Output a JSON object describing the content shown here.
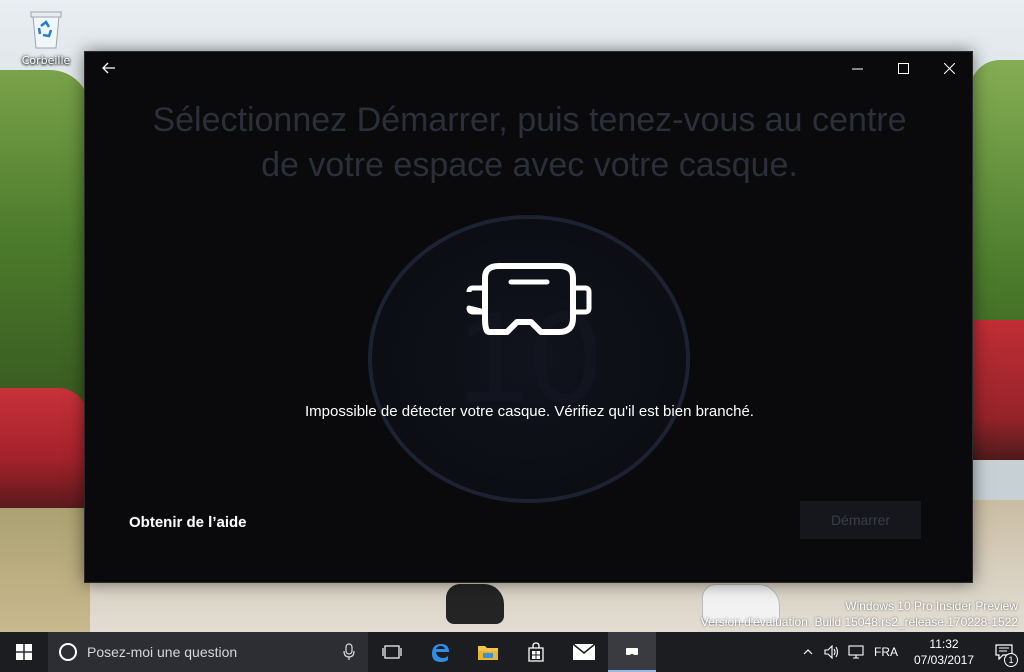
{
  "desktop": {
    "recycle_bin_label": "Corbeille",
    "watermark_line1": "Windows 10 Pro Insider Preview",
    "watermark_line2": "Version d'évaluation. Build 15048.rs2_release.170228-1522"
  },
  "window": {
    "heading": "Sélectionnez Démarrer, puis tenez-vous au centre de votre espace avec votre casque.",
    "ring_number": "10",
    "error_message": "Impossible de détecter votre casque. Vérifiez qu'il est bien branché.",
    "help_link": "Obtenir de l’aide",
    "start_button": "Démarrer"
  },
  "taskbar": {
    "search_placeholder": "Posez-moi une question",
    "language": "FRA",
    "time": "11:32",
    "date": "07/03/2017",
    "notification_count": "1"
  },
  "colors": {
    "window_bg": "#0a0a0c",
    "taskbar_bg": "#1c1d21",
    "active_task_accent": "#9ab8e6"
  }
}
